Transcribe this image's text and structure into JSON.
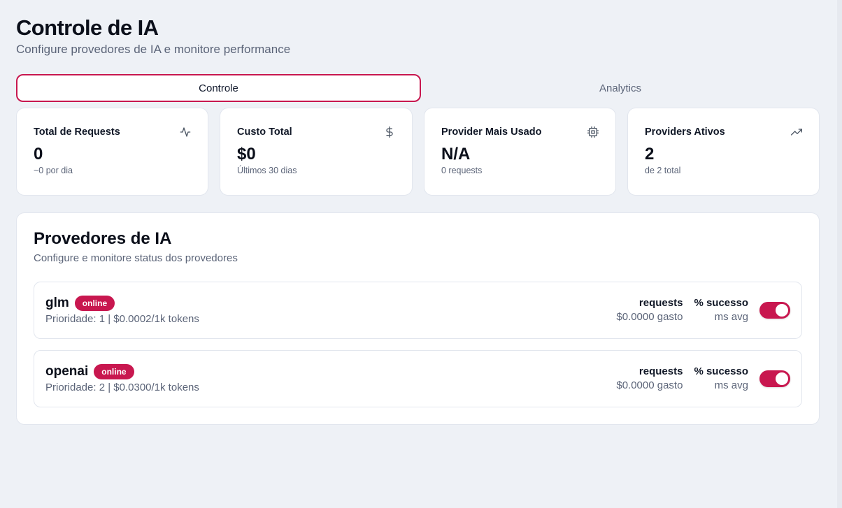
{
  "header": {
    "title": "Controle de IA",
    "subtitle": "Configure provedores de IA e monitore performance"
  },
  "tabs": [
    {
      "label": "Controle",
      "active": true
    },
    {
      "label": "Analytics",
      "active": false
    }
  ],
  "stats": [
    {
      "label": "Total de Requests",
      "icon": "activity-icon",
      "value": "0",
      "sub": "~0 por dia"
    },
    {
      "label": "Custo Total",
      "icon": "dollar-icon",
      "value": "$0",
      "sub": "Últimos 30 dias"
    },
    {
      "label": "Provider Mais Usado",
      "icon": "cpu-icon",
      "value": "N/A",
      "sub": "0 requests"
    },
    {
      "label": "Providers Ativos",
      "icon": "trending-up-icon",
      "value": "2",
      "sub": "de 2 total"
    }
  ],
  "providers": {
    "title": "Provedores de IA",
    "subtitle": "Configure e monitore status dos provedores",
    "items": [
      {
        "name": "glm",
        "status": "online",
        "meta": "Prioridade: 1 | $0.0002/1k tokens",
        "requests_label": "requests",
        "spent": "$0.0000 gasto",
        "success_label": "% sucesso",
        "avg": "ms avg",
        "enabled": true
      },
      {
        "name": "openai",
        "status": "online",
        "meta": "Prioridade: 2 | $0.0300/1k tokens",
        "requests_label": "requests",
        "spent": "$0.0000 gasto",
        "success_label": "% sucesso",
        "avg": "ms avg",
        "enabled": true
      }
    ]
  },
  "colors": {
    "accent": "#c8174f",
    "background": "#eef1f6",
    "muted_text": "#5b6478"
  }
}
